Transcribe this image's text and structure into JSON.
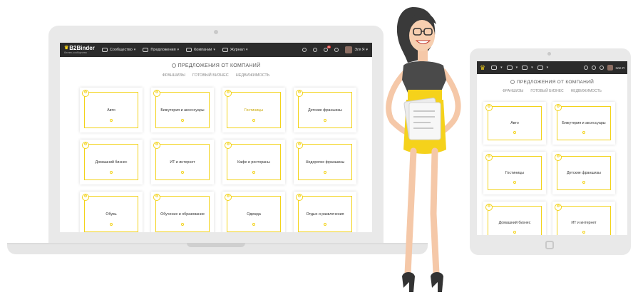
{
  "brand": {
    "name": "B2Binder",
    "tagline": "бизнес-сообщество"
  },
  "nav": {
    "items": [
      "Сообщество",
      "Предложения",
      "Компании",
      "Журнал"
    ],
    "mail_badge": "41",
    "user": "Эля Я"
  },
  "section": {
    "title": "ПРЕДЛОЖЕНИЯ ОТ КОМПАНИЙ",
    "tabs": [
      "ФРАНШИЗЫ",
      "ГОТОВЫЙ БИЗНЕС",
      "НЕДВИЖИМОСТЬ"
    ]
  },
  "laptop_cards": [
    "Авто",
    "Бижутерия и аксессуары",
    "Гостиницы",
    "Детские франшизы",
    "Домашний бизнес",
    "ИТ и интернет",
    "Кафе и рестораны",
    "Недорогие франшизы",
    "Обувь",
    "Обучение и образование",
    "Одежда",
    "Отдых и развлечения"
  ],
  "tablet_cards": [
    "Авто",
    "Бижутерия и аксессуары",
    "Гостиницы",
    "Детские франшизы",
    "Домашний бизнес",
    "ИТ и интернет"
  ],
  "card_logo_letter": "Ф",
  "colors": {
    "accent": "#f3d31a",
    "navbar": "#2b2b2b"
  }
}
